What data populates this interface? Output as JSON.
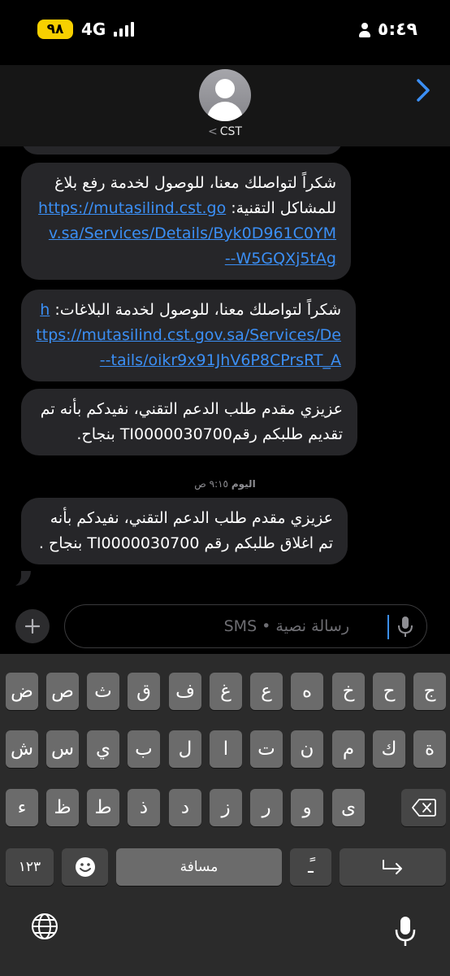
{
  "status_bar": {
    "time": "٥:٤٩",
    "battery": "٩٨",
    "network": "4G"
  },
  "header": {
    "contact_name": "CST",
    "back_glyph": "<"
  },
  "messages": [
    {
      "text": ""
    },
    {
      "text": "شكراً لتواصلك معنا، للوصول لخدمة رفع بلاغ للمشاكل التقنية:",
      "link": "https://mutasilind.cst.gov.sa/Services/Details/Byk0D961C0YMW5GQXj5tAg--"
    },
    {
      "text": "شكراً لتواصلك معنا، للوصول لخدمة البلاغات:",
      "link": "https://mutasilind.cst.gov.sa/Services/Details/oikr9x91JhV6P8CPrsRT_A--"
    },
    {
      "text": "عزيزي مقدم طلب الدعم التقني، نفيدكم بأنه تم تقديم طلبكم رقمTI0000030700 بنجاح."
    },
    {
      "text": "عزيزي مقدم طلب الدعم التقني، نفيدكم بأنه تم اغلاق طلبكم رقم TI0000030700 بنجاح ."
    }
  ],
  "timestamp": {
    "day": "اليوم",
    "time": "٩:١٥ ص"
  },
  "input": {
    "placeholder": "رسالة نصية • SMS"
  },
  "keyboard": {
    "row1": [
      "ج",
      "ح",
      "خ",
      "ه",
      "ع",
      "غ",
      "ف",
      "ق",
      "ث",
      "ص",
      "ض"
    ],
    "row2": [
      "ة",
      "ك",
      "م",
      "ن",
      "ت",
      "ا",
      "ل",
      "ب",
      "ي",
      "س",
      "ش"
    ],
    "row3": [
      "ى",
      "و",
      "ر",
      "ز",
      "د",
      "ذ",
      "ط",
      "ظ",
      "ء"
    ],
    "numbers_key": "١٢٣",
    "space_key": "مسافة",
    "tanween_key": "ًـ"
  },
  "icons": {
    "signal": "signal-bars-icon",
    "person": "person-icon",
    "avatar": "contact-avatar-icon",
    "header_chevron": "chevron-right-icon",
    "plus": "plus-icon",
    "mic": "microphone-icon",
    "delete": "delete-key-icon",
    "emoji": "emoji-icon",
    "return": "return-key-icon",
    "globe": "globe-icon"
  },
  "colors": {
    "link": "#3b8ff5",
    "bubble": "#262629",
    "battery": "#f7d000",
    "key": "#6b6b6b",
    "func_key": "#464646"
  }
}
